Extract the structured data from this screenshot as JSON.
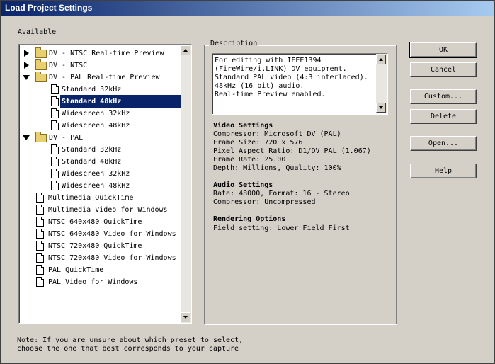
{
  "window": {
    "title": "Load Project Settings"
  },
  "available_label": "Available",
  "tree": [
    {
      "label": "DV - NTSC Real-time Preview",
      "type": "folder",
      "expanded": false,
      "level": 0
    },
    {
      "label": "DV - NTSC",
      "type": "folder",
      "expanded": false,
      "level": 0
    },
    {
      "label": "DV - PAL Real-time Preview",
      "type": "folder",
      "expanded": true,
      "level": 0
    },
    {
      "label": "Standard 32kHz",
      "type": "preset",
      "level": 1
    },
    {
      "label": "Standard 48kHz",
      "type": "preset",
      "level": 1,
      "selected": true
    },
    {
      "label": "Widescreen 32kHz",
      "type": "preset",
      "level": 1
    },
    {
      "label": "Widescreen 48kHz",
      "type": "preset",
      "level": 1
    },
    {
      "label": "DV - PAL",
      "type": "folder",
      "expanded": true,
      "level": 0
    },
    {
      "label": "Standard 32kHz",
      "type": "preset",
      "level": 1
    },
    {
      "label": "Standard 48kHz",
      "type": "preset",
      "level": 1
    },
    {
      "label": "Widescreen 32kHz",
      "type": "preset",
      "level": 1
    },
    {
      "label": "Widescreen 48kHz",
      "type": "preset",
      "level": 1
    },
    {
      "label": "Multimedia QuickTime",
      "type": "preset",
      "level": 0
    },
    {
      "label": "Multimedia Video for Windows",
      "type": "preset",
      "level": 0
    },
    {
      "label": "NTSC 640x480 QuickTime",
      "type": "preset",
      "level": 0
    },
    {
      "label": "NTSC 640x480 Video for Windows",
      "type": "preset",
      "level": 0
    },
    {
      "label": "NTSC 720x480 QuickTime",
      "type": "preset",
      "level": 0
    },
    {
      "label": "NTSC 720x480 Video for Windows",
      "type": "preset",
      "level": 0
    },
    {
      "label": "PAL QuickTime",
      "type": "preset",
      "level": 0
    },
    {
      "label": "PAL Video for Windows",
      "type": "preset",
      "level": 0
    }
  ],
  "description": {
    "label": "Description",
    "text": "For editing with IEEE1394\n(FireWire/i.LINK) DV equipment.\nStandard PAL video (4:3 interlaced).\n48kHz (16 bit) audio.\nReal-time Preview enabled.",
    "video_heading": "Video Settings",
    "video_lines": "Compressor: Microsoft DV (PAL)\nFrame Size: 720 x 576\nPixel Aspect Ratio: D1/DV PAL (1.067)\nFrame Rate: 25.00\nDepth: Millions, Quality: 100%",
    "audio_heading": "Audio Settings",
    "audio_lines": "Rate: 48000, Format: 16 - Stereo\nCompressor: Uncompressed",
    "render_heading": "Rendering Options",
    "render_lines": "Field setting: Lower Field First"
  },
  "buttons": {
    "ok": "OK",
    "cancel": "Cancel",
    "custom": "Custom...",
    "delete": "Delete",
    "open": "Open...",
    "help": "Help"
  },
  "note": "Note: If you are unsure about which preset to select,\nchoose the one that best corresponds to your capture"
}
